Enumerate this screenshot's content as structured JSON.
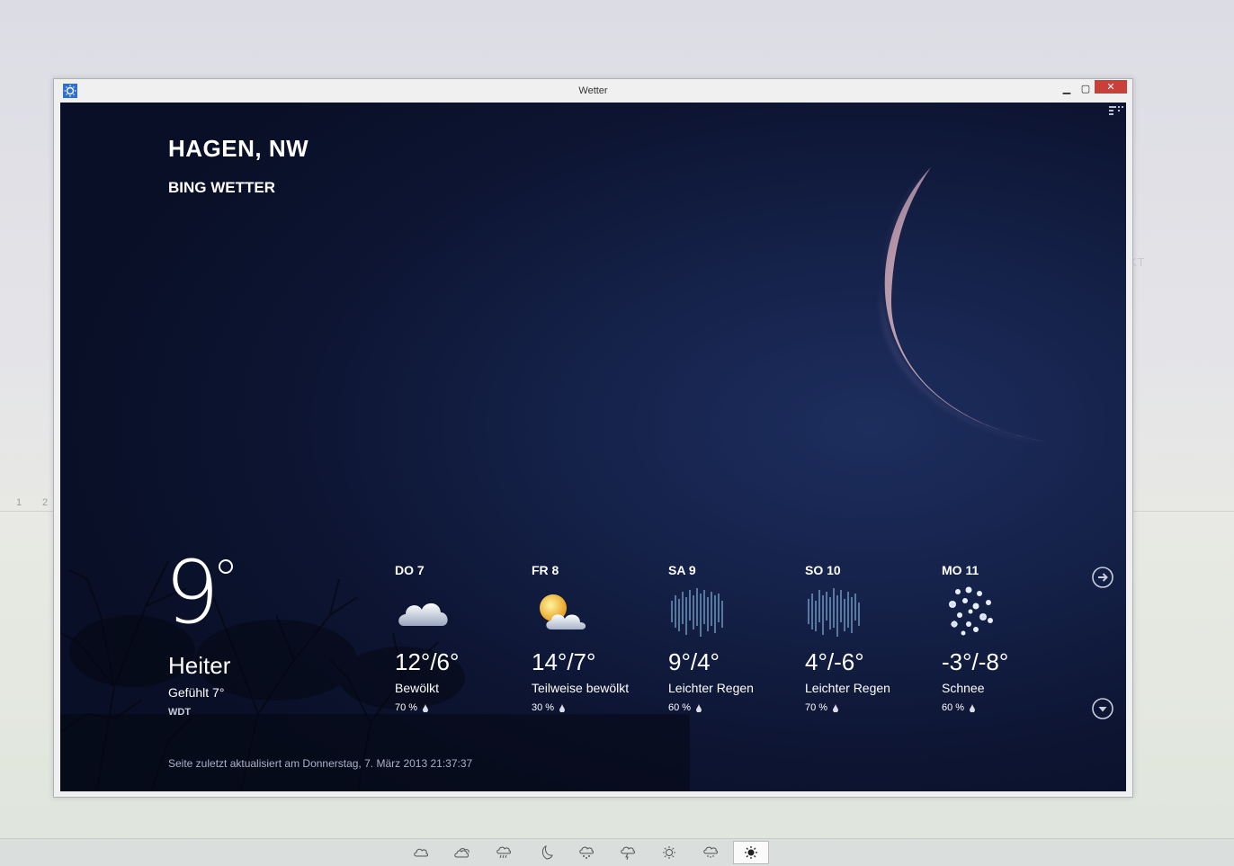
{
  "desktop": {
    "page_numbers": [
      "1",
      "2"
    ],
    "ghost_text": "KT"
  },
  "window": {
    "title": "Wetter",
    "min_glyph": "▁",
    "max_glyph": "▢",
    "close_glyph": "✕"
  },
  "location": {
    "city": "HAGEN, NW",
    "provider": "BING WETTER"
  },
  "current": {
    "temperature": "9",
    "condition": "Heiter",
    "feels_like": "Gefühlt 7°",
    "station": "WDT"
  },
  "forecast": [
    {
      "day": "DO 7",
      "temps": "12°/6°",
      "condition": "Bewölkt",
      "precip": "70 %",
      "icon": "cloudy-icon"
    },
    {
      "day": "FR 8",
      "temps": "14°/7°",
      "condition": "Teilweise bewölkt",
      "precip": "30 %",
      "icon": "partly-cloudy-icon"
    },
    {
      "day": "SA 9",
      "temps": "9°/4°",
      "condition": "Leichter Regen",
      "precip": "60 %",
      "icon": "rain-icon"
    },
    {
      "day": "SO 10",
      "temps": "4°/-6°",
      "condition": "Leichter Regen",
      "precip": "70 %",
      "icon": "rain-icon"
    },
    {
      "day": "MO 11",
      "temps": "-3°/-8°",
      "condition": "Schnee",
      "precip": "60 %",
      "icon": "snow-icon"
    }
  ],
  "updated": "Seite zuletzt aktualisiert am Donnerstag, 7. März 2013 21:37:37",
  "colors": {
    "sky_dark": "#090f26",
    "sky_mid": "#15224a",
    "close_red": "#c7403a",
    "moon": "#c2a6b4"
  },
  "taskbar": {
    "icons": [
      "cloud-icon",
      "cloudy-icon",
      "rain-cloud-icon",
      "moon-icon",
      "hail-cloud-icon",
      "storm-cloud-icon",
      "sun-outline-icon",
      "drizzle-cloud-icon",
      "sun-icon"
    ],
    "active": "sun-icon"
  }
}
